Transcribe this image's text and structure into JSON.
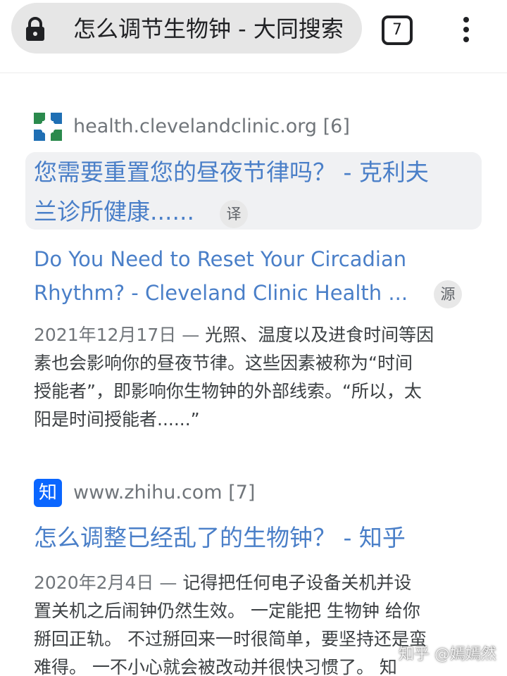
{
  "browser": {
    "address_title": "怎么调节生物钟 - 大同搜索",
    "tab_count": "7",
    "lock_icon": "lock-icon",
    "menu_icon": "more-vert-icon"
  },
  "results": [
    {
      "source": "health.clevelandclinic.org [6]",
      "favicon": "cleveland-clinic-favicon",
      "title_cn_line1": "您需要重置您的昼夜节律吗？ - 克利夫",
      "title_cn_line2": "兰诊所健康......",
      "translate_badge": "译",
      "title_en_line1": "Do You Need to Reset Your Circadian",
      "title_en_line2": "Rhythm? - Cleveland Clinic Health ...",
      "source_badge": "源",
      "date": "2021年12月17日 — ",
      "snippet_line1": "光照、温度以及进食时间等因",
      "snippet_line2": "素也会影响你的昼夜节律。这些因素被称为“时间",
      "snippet_line3": "授能者”，即影响你生物钟的外部线索。“所以，太",
      "snippet_line4": "阳是时间授能者......”"
    },
    {
      "source": "www.zhihu.com [7]",
      "favicon": "zhihu-favicon",
      "favicon_text": "知",
      "title": "怎么调整已经乱了的生物钟？ - 知乎",
      "date": "2020年2月4日 — ",
      "snippet_line1": "记得把任何电子设备关机并设",
      "snippet_line2": "置关机之后闹钟仍然生效。 一定能把 生物钟 给你",
      "snippet_line3": "掰回正轨。 不过掰回来一时很简单，要坚持还是蛮",
      "snippet_line4": "难得。 一不小心就会被改动并很快习惯了。 知"
    }
  ],
  "watermark": "知乎 @嫣嫣然",
  "colors": {
    "link": "#4a7fc8",
    "meta": "#70757a",
    "text": "#3c4043",
    "card": "#f0f1f3",
    "zhihu_blue": "#0a66ff",
    "cleveland_green": "#2b8a4d",
    "cleveland_blue": "#1f6fb4"
  }
}
